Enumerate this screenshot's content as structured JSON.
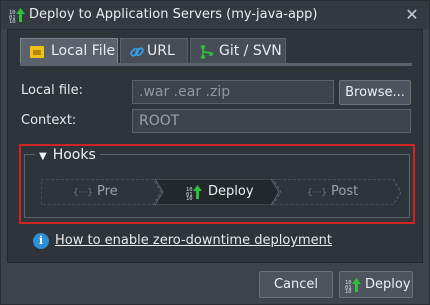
{
  "window": {
    "title": "Deploy to Application Servers (my-java-app)",
    "close_glyph": "✕"
  },
  "tabs": [
    {
      "label": "Local File",
      "icon": "local-file-icon",
      "active": true
    },
    {
      "label": "URL",
      "icon": "link-icon",
      "active": false
    },
    {
      "label": "Git / SVN",
      "icon": "git-icon",
      "active": false
    }
  ],
  "form": {
    "local_file_label": "Local file:",
    "local_file_placeholder": ".war .ear .zip",
    "browse_label": "Browse...",
    "context_label": "Context:",
    "context_value": "ROOT"
  },
  "hooks": {
    "legend": "Hooks",
    "steps": [
      {
        "label": "Pre",
        "icon": "hook-braces-icon"
      },
      {
        "label": "Deploy",
        "icon": "deploy-icon"
      },
      {
        "label": "Post",
        "icon": "hook-braces-icon"
      }
    ]
  },
  "help": {
    "icon_glyph": "i",
    "link": "How to enable zero-downtime deployment"
  },
  "footer": {
    "cancel_label": "Cancel",
    "deploy_label": "Deploy"
  },
  "colors": {
    "highlight": "#d1231f",
    "accent_green": "#2fbf3a",
    "info_blue": "#2c8fd6"
  }
}
